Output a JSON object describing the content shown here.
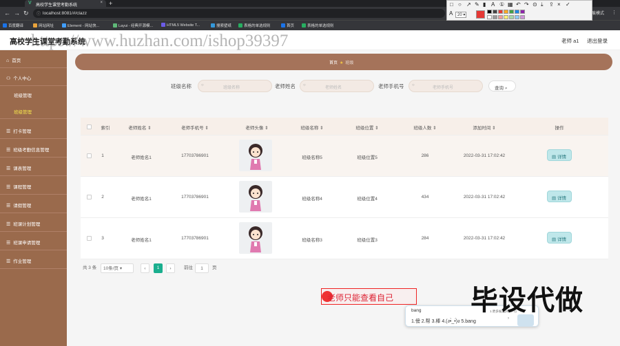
{
  "browser": {
    "tab_title": "高校学生课堂考勤系统",
    "url": "localhost:8081/#/clazz",
    "incognito": "无痕模式",
    "bookmarks": [
      "百度翻译",
      "网站网址",
      "Element - 网站快...",
      "Layui - 经典开源模...",
      "HTML5 Website T...",
      "搜索壁纸",
      "表格的单选规则",
      "首页",
      "表格的单选规则"
    ],
    "annot_size": "20"
  },
  "app": {
    "title": "高校学生课堂考勤系统",
    "user": "老师 a1",
    "logout": "退出登录"
  },
  "watermark": "https://www.huzhan.com/ishop39397",
  "sidebar": {
    "items": [
      {
        "label": "首页",
        "icon": "home-icon"
      },
      {
        "label": "个人中心",
        "icon": "person-icon"
      },
      {
        "label": "班级管理",
        "icon": ""
      },
      {
        "label": "班级管理",
        "icon": ""
      },
      {
        "label": "打卡管理",
        "icon": "menu-icon"
      },
      {
        "label": "班级考勤信息管理",
        "icon": "menu-icon"
      },
      {
        "label": "课表管理",
        "icon": "menu-icon"
      },
      {
        "label": "课程管理",
        "icon": "menu-icon"
      },
      {
        "label": "请假管理",
        "icon": "menu-icon"
      },
      {
        "label": "班课计划管理",
        "icon": "menu-icon"
      },
      {
        "label": "班课申请管理",
        "icon": "menu-icon"
      },
      {
        "label": "作业管理",
        "icon": "menu-icon"
      }
    ]
  },
  "breadcrumb": {
    "home": "首页",
    "current": "班级"
  },
  "search": {
    "class_name_label": "班级名称",
    "class_name_placeholder": "班级名称",
    "teacher_name_label": "老师姓名",
    "teacher_name_placeholder": "老师姓名",
    "teacher_phone_label": "老师手机号",
    "teacher_phone_placeholder": "老师手机号",
    "button": "查询"
  },
  "table": {
    "headers": [
      "索引",
      "老师姓名",
      "老师手机号",
      "老师头像",
      "班级名称",
      "班级位置",
      "班级人数",
      "添加时间",
      "操作"
    ],
    "rows": [
      {
        "index": "1",
        "teacher": "老师姓名1",
        "phone": "17703786901",
        "class_name": "班级名称5",
        "location": "班级位置5",
        "count": "286",
        "time": "2022-03-31 17:02:42",
        "action": "详情"
      },
      {
        "index": "2",
        "teacher": "老师姓名1",
        "phone": "17703786901",
        "class_name": "班级名称4",
        "location": "班级位置4",
        "count": "434",
        "time": "2022-03-31 17:02:42",
        "action": "详情"
      },
      {
        "index": "3",
        "teacher": "老师姓名1",
        "phone": "17703786901",
        "class_name": "班级名称3",
        "location": "班级位置3",
        "count": "284",
        "time": "2022-03-31 17:02:42",
        "action": "详情"
      }
    ]
  },
  "pager": {
    "total": "共 3 条",
    "page_size": "10条/页",
    "prev": "‹",
    "current_page": "1",
    "next": "›",
    "goto": "前往",
    "goto_value": "1",
    "page_unit": "页"
  },
  "overlay": {
    "tooltip": "老师只能查看自己",
    "ime_typed": "bang",
    "ime_hint": "1.更多候选(Shift+1)",
    "ime_candidates": "1.傍  2.帮  3.棒  4.(ง•̀_•́)ง  5.bang",
    "big_text": "毕设代做"
  },
  "colors": {
    "sidebar": "#9a6a4c",
    "banner": "#a5735a",
    "pager_active": "#1aae8e",
    "detail_btn": "#bfe7ea"
  }
}
